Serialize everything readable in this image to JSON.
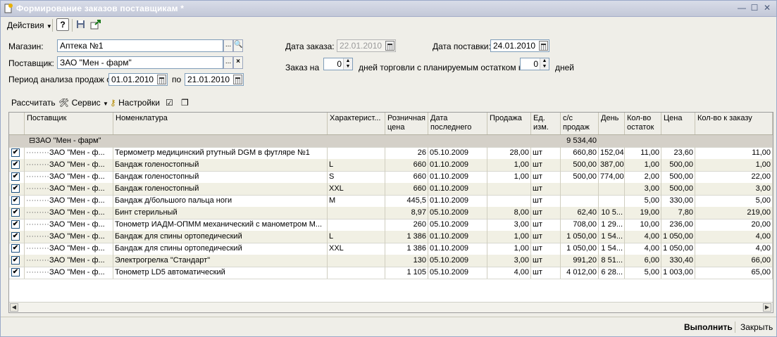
{
  "window": {
    "title": "Формирование заказов поставщикам *"
  },
  "toolbar": {
    "actions": "Действия",
    "help": "?"
  },
  "form": {
    "shop_label": "Магазин:",
    "shop_value": "Аптека №1",
    "supplier_label": "Поставщик:",
    "supplier_value": "ЗАО \"Мен - фарм\"",
    "period_label": "Период анализа продаж с:",
    "period_from": "01.01.2010",
    "period_to_label": "по",
    "period_to": "21.01.2010",
    "order_date_label": "Дата заказа:",
    "order_date": "22.01.2010",
    "delivery_date_label": "Дата поставки:",
    "delivery_date": "24.01.2010",
    "order_for_label": "Заказ на",
    "order_days": "0",
    "days_text": "дней торговли с планируемым остатком на",
    "remain_days": "0",
    "days_suffix": "дней",
    "ellipsis": "...",
    "clear": "×"
  },
  "commands": {
    "calculate": "Рассчитать",
    "service": "Сервис",
    "settings": "Настройки"
  },
  "grid": {
    "columns": [
      "",
      "Поставщик",
      "Номенклатура",
      "Характерист...",
      "Розничная цена",
      "Дата последнего",
      "Продажа",
      "Ед. изм.",
      "с/с продаж",
      "День",
      "Кол-во остаток",
      "Цена",
      "Кол-во к заказу"
    ],
    "group": {
      "label": "ЗАО \"Мен - фарм\"",
      "cc_total": "9 534,40"
    },
    "rows": [
      {
        "supplier": "ЗАО \"Мен - ф...",
        "item": "Термометр медицинский ртутный DGM в футляре №1",
        "char": "",
        "price": "26",
        "date": "05.10.2009",
        "sale": "28,00",
        "unit": "шт",
        "cc": "660,80",
        "day": "152,04",
        "rest": "11,00",
        "cost": "23,60",
        "qty": "11,00"
      },
      {
        "supplier": "ЗАО \"Мен - ф...",
        "item": "Бандаж голеностопный",
        "char": "L",
        "price": "660",
        "date": "01.10.2009",
        "sale": "1,00",
        "unit": "шт",
        "cc": "500,00",
        "day": "387,00",
        "rest": "1,00",
        "cost": "500,00",
        "qty": "1,00"
      },
      {
        "supplier": "ЗАО \"Мен - ф...",
        "item": "Бандаж голеностопный",
        "char": "S",
        "price": "660",
        "date": "01.10.2009",
        "sale": "1,00",
        "unit": "шт",
        "cc": "500,00",
        "day": "774,00",
        "rest": "2,00",
        "cost": "500,00",
        "qty": "22,00"
      },
      {
        "supplier": "ЗАО \"Мен - ф...",
        "item": "Бандаж голеностопный",
        "char": "XXL",
        "price": "660",
        "date": "01.10.2009",
        "sale": "",
        "unit": "шт",
        "cc": "",
        "day": "",
        "rest": "3,00",
        "cost": "500,00",
        "qty": "3,00"
      },
      {
        "supplier": "ЗАО \"Мен - ф...",
        "item": "Бандаж д/большого пальца ноги",
        "char": "M",
        "price": "445,5",
        "date": "01.10.2009",
        "sale": "",
        "unit": "шт",
        "cc": "",
        "day": "",
        "rest": "5,00",
        "cost": "330,00",
        "qty": "5,00"
      },
      {
        "supplier": "ЗАО \"Мен - ф...",
        "item": "Бинт стерильный",
        "char": "",
        "price": "8,97",
        "date": "05.10.2009",
        "sale": "8,00",
        "unit": "шт",
        "cc": "62,40",
        "day": "10 5...",
        "rest": "19,00",
        "cost": "7,80",
        "qty": "219,00"
      },
      {
        "supplier": "ЗАО \"Мен - ф...",
        "item": "Тонометр ИАДМ-ОПММ механический с манометром М...",
        "char": "",
        "price": "260",
        "date": "05.10.2009",
        "sale": "3,00",
        "unit": "шт",
        "cc": "708,00",
        "day": "1 29...",
        "rest": "10,00",
        "cost": "236,00",
        "qty": "20,00"
      },
      {
        "supplier": "ЗАО \"Мен - ф...",
        "item": "Бандаж для спины ортопедический",
        "char": "L",
        "price": "1 386",
        "date": "01.10.2009",
        "sale": "1,00",
        "unit": "шт",
        "cc": "1 050,00",
        "day": "1 54...",
        "rest": "4,00",
        "cost": "1 050,00",
        "qty": "4,00"
      },
      {
        "supplier": "ЗАО \"Мен - ф...",
        "item": "Бандаж для спины ортопедический",
        "char": "XXL",
        "price": "1 386",
        "date": "01.10.2009",
        "sale": "1,00",
        "unit": "шт",
        "cc": "1 050,00",
        "day": "1 54...",
        "rest": "4,00",
        "cost": "1 050,00",
        "qty": "4,00"
      },
      {
        "supplier": "ЗАО \"Мен - ф...",
        "item": "Электрогрелка \"Стандарт\"",
        "char": "",
        "price": "130",
        "date": "05.10.2009",
        "sale": "3,00",
        "unit": "шт",
        "cc": "991,20",
        "day": "8 51...",
        "rest": "6,00",
        "cost": "330,40",
        "qty": "66,00"
      },
      {
        "supplier": "ЗАО \"Мен - ф...",
        "item": "Тонометр LD5 автоматический",
        "char": "",
        "price": "1 105",
        "date": "05.10.2009",
        "sale": "4,00",
        "unit": "шт",
        "cc": "4 012,00",
        "day": "6 28...",
        "rest": "5,00",
        "cost": "1 003,00",
        "qty": "65,00"
      }
    ],
    "check_mark": "✔",
    "tree_prefix": "·········"
  },
  "footer": {
    "execute": "Выполнить",
    "close": "Закрыть"
  }
}
